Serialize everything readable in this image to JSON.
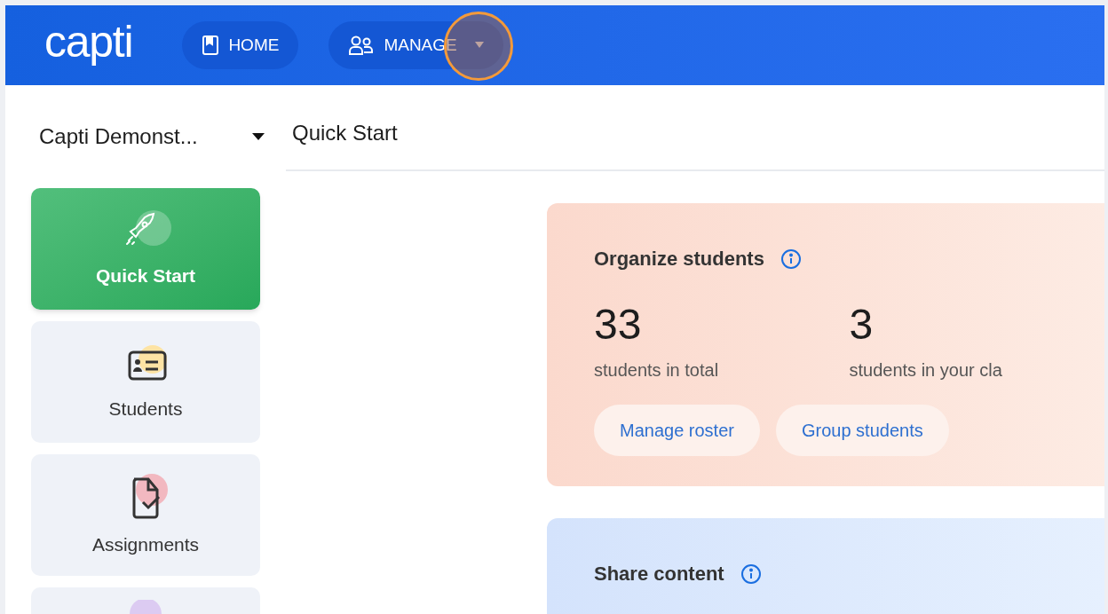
{
  "header": {
    "logo": "capti",
    "nav": [
      {
        "label": "HOME",
        "kind": "home",
        "dropdown": false
      },
      {
        "label": "MANAGE",
        "kind": "manage",
        "dropdown": true
      }
    ],
    "click_marker": true
  },
  "sidebar": {
    "class_selector": "Capti Demonst...",
    "items": [
      {
        "label": "Quick Start",
        "kind": "rocket",
        "selected": true
      },
      {
        "label": "Students",
        "kind": "id-card",
        "selected": false,
        "color": "#fde3a4"
      },
      {
        "label": "Assignments",
        "kind": "document-check",
        "selected": false,
        "color": "#f2b8c0"
      },
      {
        "kind": "partial",
        "selected": false,
        "color": "#dccbf2"
      }
    ]
  },
  "main": {
    "title": "Quick Start",
    "cards": [
      {
        "title": "Organize students",
        "kind": "peach",
        "stats": [
          {
            "value": "33",
            "label": "students in total"
          },
          {
            "value": "3",
            "label": "students in your cla"
          }
        ],
        "buttons": [
          "Manage roster",
          "Group students"
        ]
      },
      {
        "title": "Share content",
        "kind": "blue"
      }
    ]
  }
}
